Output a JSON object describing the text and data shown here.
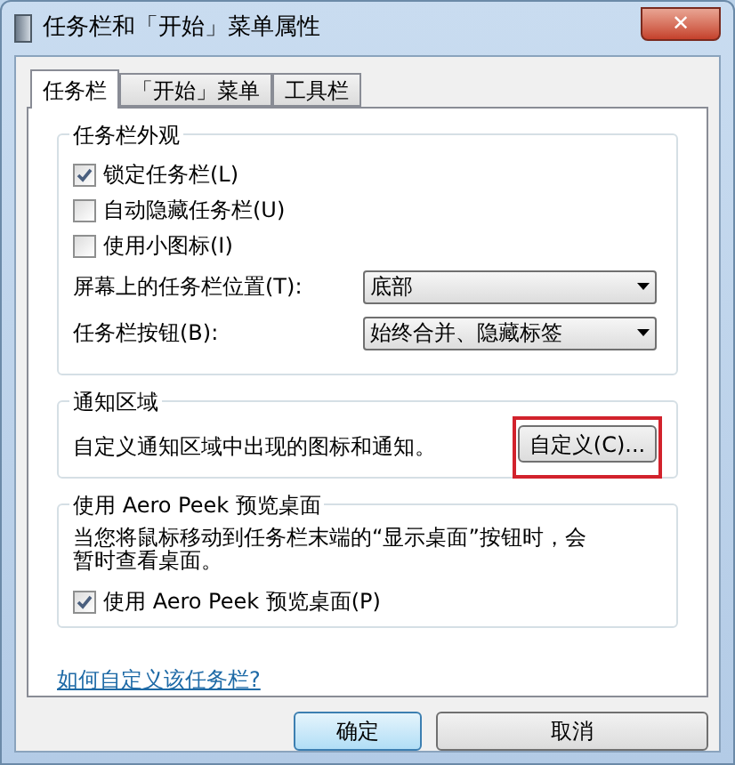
{
  "window": {
    "title": "任务栏和「开始」菜单属性",
    "close": "✕"
  },
  "tabs": [
    {
      "label": "任务栏",
      "selected": true
    },
    {
      "label": "「开始」菜单",
      "selected": false
    },
    {
      "label": "工具栏",
      "selected": false
    }
  ],
  "appearance": {
    "title": "任务栏外观",
    "checkboxes": [
      {
        "label": "锁定任务栏(L)",
        "checked": true
      },
      {
        "label": "自动隐藏任务栏(U)",
        "checked": false
      },
      {
        "label": "使用小图标(I)",
        "checked": false
      }
    ],
    "dropdowns": [
      {
        "label": "屏幕上的任务栏位置(T):",
        "value": "底部"
      },
      {
        "label": "任务栏按钮(B):",
        "value": "始终合并、隐藏标签"
      }
    ]
  },
  "notification": {
    "title": "通知区域",
    "text": "自定义通知区域中出现的图标和通知。",
    "button": "自定义(C)..."
  },
  "aero_peek": {
    "title": "使用 Aero Peek 预览桌面",
    "text": "当您将鼠标移动到任务栏末端的“显示桌面”按钮时，会暂时查看桌面。",
    "checkbox": {
      "label": "使用 Aero Peek 预览桌面(P)",
      "checked": true
    }
  },
  "link": "如何自定义该任务栏?",
  "buttons": [
    {
      "label": "确定",
      "default": true
    },
    {
      "label": "取消",
      "default": false
    }
  ]
}
